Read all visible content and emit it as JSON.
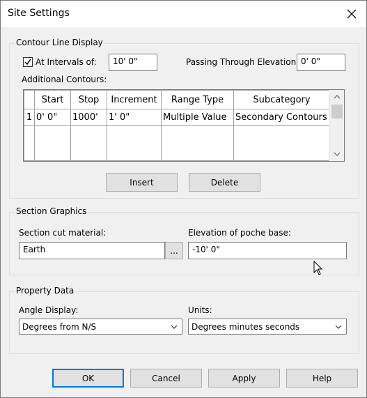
{
  "window": {
    "title": "Site Settings"
  },
  "contour": {
    "group_label": "Contour Line Display",
    "intervals_label": "At Intervals of:",
    "intervals_checked": true,
    "intervals_value": "10'  0\"",
    "passing_label": "Passing Through Elevation:",
    "passing_value": "0'  0\"",
    "additional_label": "Additional Contours:",
    "table": {
      "headers": [
        "Start",
        "Stop",
        "Increment",
        "Range Type",
        "Subcategory"
      ],
      "rows": [
        {
          "num": "1",
          "start": "0'  0\"",
          "stop": "1000'",
          "increment": "1'  0\"",
          "range_type": "Multiple Value",
          "subcategory": "Secondary Contours"
        }
      ]
    },
    "insert_label": "Insert",
    "delete_label": "Delete"
  },
  "section": {
    "group_label": "Section Graphics",
    "material_label": "Section cut material:",
    "material_value": "Earth",
    "browse_label": "...",
    "elevation_label": "Elevation of poche base:",
    "elevation_value": "-10'  0\""
  },
  "property": {
    "group_label": "Property Data",
    "angle_label": "Angle Display:",
    "angle_value": "Degrees from N/S",
    "units_label": "Units:",
    "units_value": "Degrees minutes seconds"
  },
  "buttons": {
    "ok": "OK",
    "cancel": "Cancel",
    "apply": "Apply",
    "help": "Help"
  },
  "colors": {
    "accent": "#0078d7",
    "face": "#f0f0f0",
    "button": "#e1e1e1"
  }
}
